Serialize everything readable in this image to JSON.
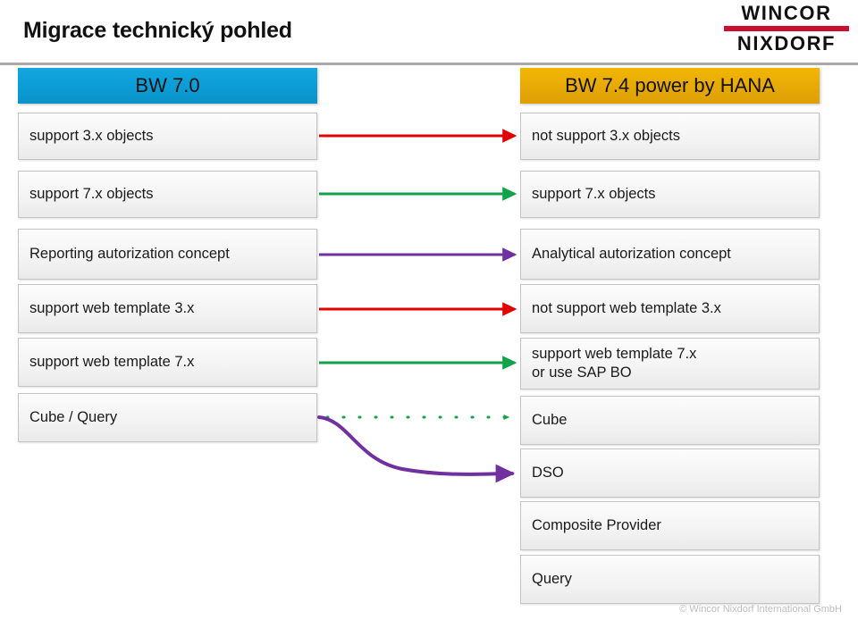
{
  "header": {
    "title": "Migrace technický pohled",
    "logo": {
      "line1": "WINCOR",
      "line2": "NIXDORF",
      "bar_color": "#c8102e"
    }
  },
  "columns": {
    "left": {
      "header": {
        "label": "BW 7.0",
        "color": "#0c9dd6"
      },
      "items": [
        {
          "label": "support 3.x objects"
        },
        {
          "label": "support 7.x objects"
        },
        {
          "label": "Reporting autorization concept"
        },
        {
          "label": "support web template 3.x"
        },
        {
          "label": "support web template 7.x"
        },
        {
          "label": "Cube / Query"
        }
      ]
    },
    "right": {
      "header": {
        "label": "BW 7.4 power by HANA",
        "color": "#e8aa06"
      },
      "items": [
        {
          "label": "not support 3.x objects"
        },
        {
          "label": "support 7.x objects"
        },
        {
          "label": "Analytical autorization concept"
        },
        {
          "label": "not support web template 3.x"
        },
        {
          "label": "support web template 7.x\nor use SAP BO"
        },
        {
          "label": "Cube"
        },
        {
          "label": "DSO"
        },
        {
          "label": "Composite Provider"
        },
        {
          "label": "Query"
        }
      ]
    }
  },
  "connectors": [
    {
      "from": "support 3.x objects",
      "to": "not support 3.x objects",
      "color": "#e00000",
      "style": "solid"
    },
    {
      "from": "support 7.x objects",
      "to": "support 7.x objects",
      "color": "#11a24a",
      "style": "solid"
    },
    {
      "from": "Reporting autorization concept",
      "to": "Analytical autorization concept",
      "color": "#7030a0",
      "style": "solid"
    },
    {
      "from": "support web template 3.x",
      "to": "not support web template 3.x",
      "color": "#e00000",
      "style": "solid"
    },
    {
      "from": "support web template 7.x",
      "to": "support web template 7.x or use SAP BO",
      "color": "#11a24a",
      "style": "solid"
    },
    {
      "from": "Cube / Query",
      "to": "Cube",
      "color": "#11a24a",
      "style": "dotted"
    },
    {
      "from": "Cube / Query",
      "to": "DSO",
      "color": "#7030a0",
      "style": "curved"
    }
  ],
  "footer": {
    "copyright": "© Wincor Nixdorf International GmbH"
  }
}
